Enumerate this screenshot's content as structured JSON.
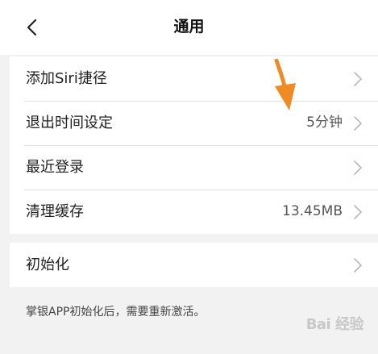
{
  "header": {
    "back_icon": "chevron-left-icon",
    "title": "通用"
  },
  "settings": {
    "group1": [
      {
        "label": "添加Siri捷径",
        "value": ""
      },
      {
        "label": "退出时间设定",
        "value": "5分钟"
      },
      {
        "label": "最近登录",
        "value": ""
      },
      {
        "label": "清理缓存",
        "value": "13.45MB"
      }
    ],
    "group2": [
      {
        "label": "初始化",
        "value": ""
      }
    ],
    "reset_note": "掌银APP初始化后，需要重新激活。"
  },
  "annotation": {
    "arrow_color": "#f08a24"
  },
  "watermark": {
    "text": "Bai 经验"
  },
  "colors": {
    "background": "#f2f2f2",
    "row_background": "#ffffff",
    "chevron": "#b9b9b9"
  }
}
